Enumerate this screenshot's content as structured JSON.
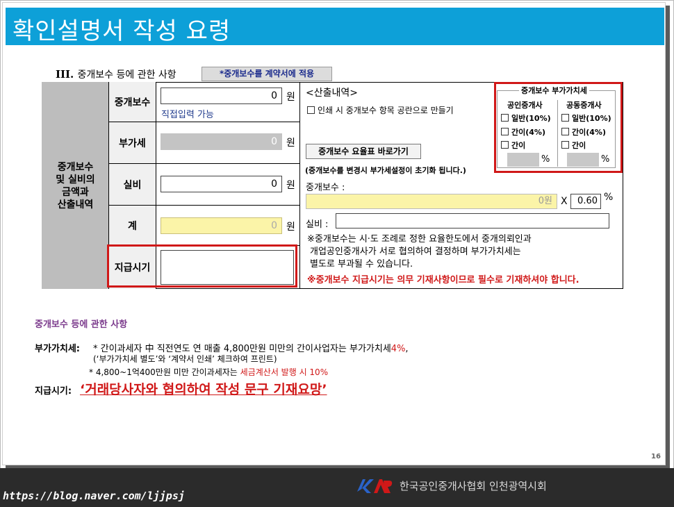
{
  "slide": {
    "title": "확인설명서 작성 요령",
    "page_number": "16"
  },
  "section": {
    "title_prefix": "III.",
    "title": "중개보수 등에 관한 사항",
    "apply_tag": "*중개보수를 계약서에 적용"
  },
  "table": {
    "row_header": [
      "중개보수",
      "및 실비의",
      "금액과",
      "산출내역"
    ],
    "rows": [
      {
        "label": "중개보수",
        "value": "0",
        "unit": "원",
        "hint": "직접입력 가능"
      },
      {
        "label": "부가세",
        "value": "0",
        "unit": "원"
      },
      {
        "label": "실비",
        "value": "0",
        "unit": "원"
      },
      {
        "label": "계",
        "value": "0",
        "unit": "원"
      },
      {
        "label": "지급시기",
        "value": ""
      }
    ]
  },
  "calc": {
    "title": "<산출내역>",
    "print_option": "인쇄 시 중개보수 항목 공란으로 만들기",
    "fee_table_button": "중개보수 요율표 바로가기",
    "reset_note": "(중개보수를 변경시 부가세설정이 초기화 됩니다.)",
    "fee_label": "중개보수 :",
    "fee_value": "0원",
    "times": "X",
    "rate": "0.60",
    "rate_unit": "%",
    "expense_label": "실비 :",
    "notice_lines": [
      "※중개보수는 시·도 조례로 정한 요율한도에서 중개의뢰인과",
      "개업공인중개사가 서로 협의하여 결정하며 부가가치세는",
      "별도로 부과될 수 있습니다."
    ],
    "warning": "※중개보수 지급시기는 의무 기재사항이므로 필수로 기재하셔야 합니다."
  },
  "vat_panel": {
    "title": "중개보수 부가가치세",
    "columns": [
      {
        "title": "공인중개사",
        "options": [
          "일반(10%)",
          "간이(4%)",
          "간이"
        ],
        "unit": "%"
      },
      {
        "title": "공동중개사",
        "options": [
          "일반(10%)",
          "간이(4%)",
          "간이"
        ],
        "unit": "%"
      }
    ]
  },
  "notes": {
    "title": "중개보수 등에 관한 사항",
    "vat_label": "부가가치세:",
    "vat_line1_a": "* 간이과세자 中 직전연도 연 매출 4,800만원 미만의 간이사업자는 부가가치세",
    "vat_line1_b": "4%",
    "vat_line1_c": ",",
    "vat_line2": "(‘부가가치세 별도’와 ‘계약서 인쇄’ 체크하여 프린트)",
    "vat_line3_a": "* 4,800~1억400만원  미만 간이과세자는 ",
    "vat_line3_b": "세금계산서 발행 시 10%",
    "pay_label": "지급시기:",
    "pay_text": "‘거래당사자와 협의하여 작성 문구 기재요망’"
  },
  "footer": {
    "url": "https://blog.naver.com/ljjpsj",
    "logo_text": "KAR",
    "org": "한국공인중개사협회 인천광역시회"
  }
}
